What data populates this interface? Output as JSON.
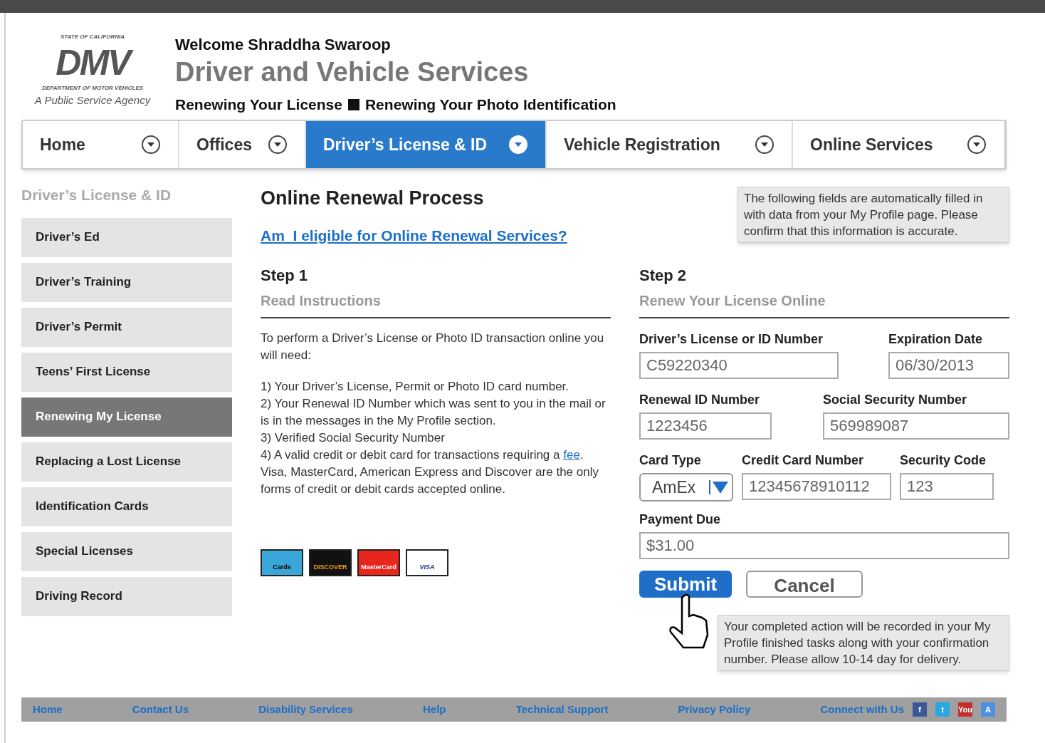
{
  "logo": {
    "top": "STATE OF CALIFORNIA",
    "mark": "DMV",
    "bottom": "DEPARTMENT OF MOTOR VEHICLES",
    "tagline": "A Public Service Agency"
  },
  "header": {
    "welcome": "Welcome Shraddha Swaroop",
    "title": "Driver and Vehicle Services",
    "breadcrumb": [
      "Renewing Your License",
      "Renewing Your Photo Identification"
    ]
  },
  "nav": [
    {
      "label": "Home",
      "selected": false
    },
    {
      "label": "Offices",
      "selected": false
    },
    {
      "label": "Driver’s License & ID",
      "selected": true
    },
    {
      "label": "Vehicle Registration",
      "selected": false
    },
    {
      "label": "Online Services",
      "selected": false
    }
  ],
  "sidebar": {
    "title": "Driver’s License & ID",
    "items": [
      {
        "label": "Driver’s Ed",
        "selected": false
      },
      {
        "label": "Driver’s Training",
        "selected": false
      },
      {
        "label": "Driver’s Permit",
        "selected": false
      },
      {
        "label": "Teens’ First License",
        "selected": false
      },
      {
        "label": "Renewing My License",
        "selected": true
      },
      {
        "label": "Replacing a Lost License",
        "selected": false
      },
      {
        "label": "Identification Cards",
        "selected": false
      },
      {
        "label": "Special Licenses",
        "selected": false
      },
      {
        "label": "Driving Record",
        "selected": false
      }
    ]
  },
  "main": {
    "title": "Online Renewal Process",
    "eligibility_link": "Am  I eligible for Online Renewal Services?",
    "tooltip_top": "The following fields are automatically filled in with data from your My Profile page. Please confirm that this information is accurate.",
    "step1": {
      "heading": "Step 1",
      "subheading": "Read Instructions",
      "intro": "To perform a Driver’s License or Photo ID transaction online you will need:",
      "items": [
        "1) Your Driver’s License, Permit or Photo ID card number.",
        "2) Your Renewal ID Number which was sent to you in the mail or is in the messages in the My Profile section.",
        "3) Verified Social Security Number"
      ],
      "item4_start": "4) A valid credit or debit card for transactions requiring a",
      "fee_link": "fee",
      "item4_end": ". Visa, MasterCard, American Express and Discover are the only forms of credit or debit cards accepted online.",
      "cards": [
        {
          "kind": "amex",
          "label": "Cards"
        },
        {
          "kind": "discover",
          "label": "DISCOVER"
        },
        {
          "kind": "mastercard",
          "label": "MasterCard"
        },
        {
          "kind": "visa",
          "label": "VISA"
        }
      ]
    },
    "step2": {
      "heading": "Step 2",
      "subheading": "Renew Your License Online",
      "license_number": {
        "label": "Driver’s License or ID Number",
        "value": "C59220340"
      },
      "expiration": {
        "label": "Expiration Date",
        "value": "06/30/2013"
      },
      "renewal_id": {
        "label": "Renewal ID Number",
        "value": "1223456"
      },
      "ssn": {
        "label": "Social Security Number",
        "value": "569989087"
      },
      "card_type": {
        "label": "Card Type",
        "value": "AmEx"
      },
      "card_number": {
        "label": "Credit Card Number",
        "value": "12345678910112"
      },
      "security_code": {
        "label": "Security Code",
        "value": "123"
      },
      "payment_due": {
        "label": "Payment Due",
        "value": "$31.00"
      },
      "buttons": [
        {
          "kind": "primary",
          "label": "Submit"
        },
        {
          "kind": "secondary",
          "label": "Cancel"
        }
      ],
      "tooltip_bottom": "Your completed action will be recorded in your My Profile finished tasks along with your confirmation number. Please allow 10-14 day for delivery."
    }
  },
  "footer": {
    "links": [
      "Home",
      "Contact Us",
      "Disability Services",
      "Help",
      "Technical Support",
      "Privacy Policy"
    ],
    "connect": "Connect with Us",
    "social": [
      {
        "kind": "facebook",
        "label": "f"
      },
      {
        "kind": "twitter",
        "label": "t"
      },
      {
        "kind": "youtube",
        "label": "You"
      },
      {
        "kind": "appstore",
        "label": "A"
      }
    ]
  }
}
